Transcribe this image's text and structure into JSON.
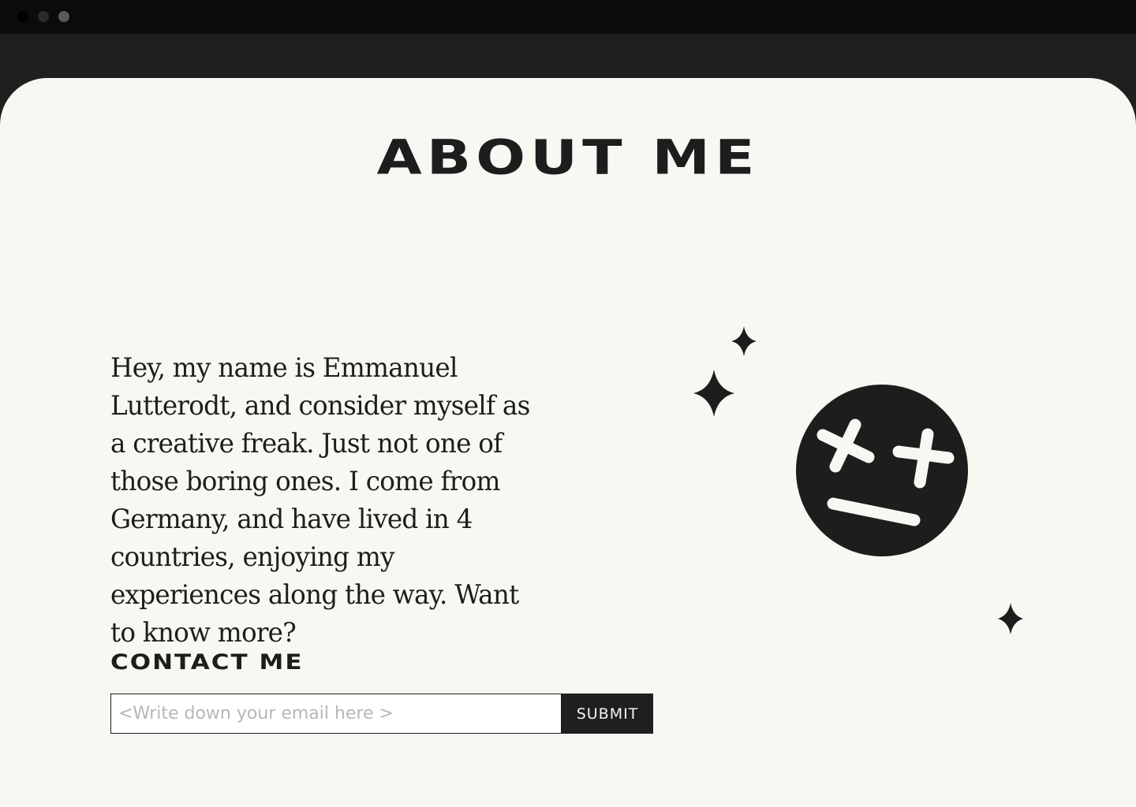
{
  "window": {
    "controls": [
      "close",
      "minimize",
      "zoom"
    ],
    "dot_colors": [
      "#000000",
      "#2a2a2a",
      "#5a5a5a"
    ]
  },
  "page": {
    "title": "ABOUT ME",
    "bio": "Hey, my name is Emmanuel Lutterodt, and consider myself as a creative freak. Just not one of those boring ones. I come from Germany, and have lived in 4 countries, enjoying my experiences along the way. Want to know more?",
    "contact": {
      "heading": "CONTACT ME",
      "email_placeholder": "<Write down your email here >",
      "email_value": "",
      "submit_label": "SUBMIT"
    },
    "illustration": {
      "face_icon": "dizzy-face-icon",
      "sparkle_icon": "sparkle-icon"
    }
  },
  "colors": {
    "page_background": "#f9f7f1",
    "ink": "#1d1d1d",
    "chrome_dark": "#0b0b0b",
    "chrome": "#1f1f1f"
  }
}
